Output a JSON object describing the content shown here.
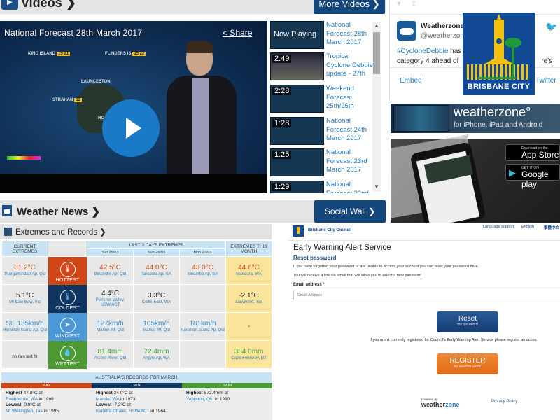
{
  "videos": {
    "header": "Videos",
    "more_button": "More Videos",
    "player": {
      "title": "National Forecast 28th March 2017",
      "share": "Share",
      "map_labels": [
        {
          "name": "KING ISLAND",
          "temps": "15 21"
        },
        {
          "name": "FLINDERS IS",
          "temps": "15 22"
        },
        {
          "name": "LAUNCESTON",
          "temps": ""
        },
        {
          "name": "STRAHAN",
          "temps": "12"
        },
        {
          "name": "HO",
          "temps": ""
        }
      ]
    },
    "playlist": [
      {
        "duration": "",
        "status": "Now Playing",
        "title": "National Forecast 28th March 2017"
      },
      {
        "duration": "2:49",
        "status": "",
        "title": "Tropical Cyclone Debbie update - 27th"
      },
      {
        "duration": "2:28",
        "status": "",
        "title": "Weekend Forecast 25th/26th"
      },
      {
        "duration": "1:28",
        "status": "",
        "title": "National Forecast 24th March 2017"
      },
      {
        "duration": "1:25",
        "status": "",
        "title": "National Forecast 23rd March 2017"
      },
      {
        "duration": "1:29",
        "status": "",
        "title": "National Forecast 22nd"
      }
    ]
  },
  "news": {
    "header": "Weather News",
    "social_wall": "Social Wall"
  },
  "twitter": {
    "name": "Weatherzone",
    "handle": "@weatherzone",
    "hashtag": "#CycloneDebbie",
    "text1_rest": " has",
    "text2": "category 4 ahead of",
    "text2_tail": "re's",
    "embed": "Embed",
    "view_on": "n Twitter"
  },
  "bcc_logo": {
    "text": "BRISBANE CITY"
  },
  "app_banner": {
    "brand": "weatherzone°",
    "subtitle": "for iPhone, iPad and Android"
  },
  "app_promo": {
    "appstore_small": "Download on the",
    "appstore_big": "App Store",
    "google_small": "GET IT ON",
    "google_big": "Google play"
  },
  "extremes": {
    "header": "Extremes and Records",
    "col_current": "CURRENT EXTREMES",
    "col_last3": "LAST 3 DAYS EXTREMES",
    "col_month": "EXTREMES THIS MONTH",
    "days": [
      "Sat 25/03",
      "Sun 26/03",
      "Mon 27/03"
    ],
    "rows": [
      {
        "type": "hot",
        "label": "HOTTEST",
        "current": {
          "value": "31.2°C",
          "location": "Thargomindah Ap, Qld"
        },
        "days": [
          {
            "value": "42.5°C",
            "location": "Birdsville Ap, Qld"
          },
          {
            "value": "44.0°C",
            "location": "Tarcoola Ap, SA"
          },
          {
            "value": "43.0°C",
            "location": "Moomba Ap, SA"
          }
        ],
        "month": {
          "value": "44.6°C",
          "location": "Mandora, WA"
        }
      },
      {
        "type": "cold",
        "label": "COLDEST",
        "current": {
          "value": "5.1°C",
          "location": "Mt Baw Baw, Vic"
        },
        "days": [
          {
            "value": "4.4°C",
            "location": "Perisher Valley, NSW/ACT"
          },
          {
            "value": "3.3°C",
            "location": "Collie East, WA"
          },
          {
            "value": "",
            "location": ""
          }
        ],
        "month": {
          "value": "-2.1°C",
          "location": "Liawenee, Tas"
        }
      },
      {
        "type": "wind",
        "label": "WINDIEST",
        "current": {
          "value": "SE 135km/h",
          "location": "Hamilton Island Ap, Qld"
        },
        "days": [
          {
            "value": "127km/h",
            "location": "Marion Rf, Qld"
          },
          {
            "value": "105km/h",
            "location": "Marion Rf, Qld"
          },
          {
            "value": "181km/h",
            "location": "Hamilton Island Ap, Qld"
          }
        ],
        "month": {
          "value": "-",
          "location": ""
        }
      },
      {
        "type": "wet",
        "label": "WETTEST",
        "current": {
          "value": "",
          "location": "",
          "note": "no rain last hr"
        },
        "days": [
          {
            "value": "81.4mm",
            "location": "Archer River, Qld"
          },
          {
            "value": "72.4mm",
            "location": "Argyle Ap, WA"
          },
          {
            "value": "",
            "location": ""
          }
        ],
        "month": {
          "value": "384.0mm",
          "location": "Cape Fourcroy, NT"
        }
      }
    ]
  },
  "records": {
    "title": "AUSTRALIA'S RECORDS FOR MARCH",
    "columns": [
      {
        "header": "MAX",
        "color": "#cf4515",
        "highest_label": "Highest",
        "highest_value": "47.8°C at",
        "highest_place": "Roebourne, WA",
        "highest_year": "in 1998",
        "lowest_label": "Lowest",
        "lowest_value": "-0.9°C at",
        "lowest_place": "Mt Wellington, Tas",
        "lowest_year": "in 1995"
      },
      {
        "header": "MIN",
        "color": "#0f3560",
        "highest_label": "Highest",
        "highest_value": "34.0°C at",
        "highest_place": "Mardie, WA",
        "highest_year": "in 1973",
        "lowest_label": "Lowest",
        "lowest_value": "-7.2°C at",
        "lowest_place": "Kiandra Chalet, NSW/ACT",
        "lowest_year": "in 1964"
      },
      {
        "header": "RAIN",
        "color": "#4d9a34",
        "highest_label": "Highest",
        "highest_value": "572.4mm at",
        "highest_place": "Yeppoon, Qld",
        "highest_year": "in 1990",
        "lowest_label": "",
        "lowest_value": "",
        "lowest_place": "",
        "lowest_year": ""
      }
    ]
  },
  "bcc_form": {
    "council": "Brisbane City Council",
    "lang_support": "Language support",
    "lang_en": "English",
    "lang_zh": "繁體中文",
    "title": "Early Warning Alert Service",
    "subtitle": "Reset password",
    "info1": "If you have forgotten your password or are unable to access your account you can reset your password here.",
    "info2": "You will receive a link via email that will allow you to select a new password.",
    "email_label": "Email address",
    "email_required": "*",
    "email_placeholder": "Email Address",
    "email_value": "",
    "reset_big": "Reset",
    "reset_small": "my password",
    "register_info": "If you aren't currently registered for Council's Early Warning Alert Service please register an accou",
    "register_big": "REGISTER",
    "register_small": "for weather alerts",
    "powered_by": "powered by",
    "wz_weather": "weather",
    "wz_zone": "zone",
    "privacy": "Privacy Policy"
  }
}
